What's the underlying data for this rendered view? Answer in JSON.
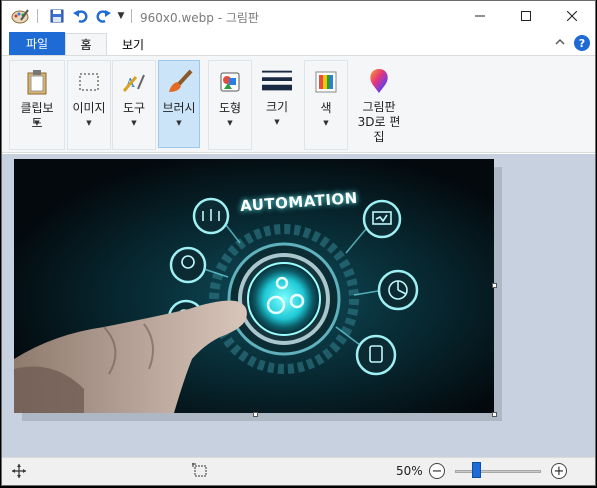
{
  "window": {
    "title": "960x0.webp - 그림판"
  },
  "tabs": {
    "file": "파일",
    "home": "홈",
    "view": "보기"
  },
  "help_label": "?",
  "ribbon": {
    "clipboard": "클립보드",
    "image": "이미지",
    "tools": "도구",
    "brushes": "브러시",
    "shapes": "도형",
    "size": "크기",
    "colors": "색",
    "edit_paint3d": "그림판 3D로 편집"
  },
  "image_text": "AUTOMATION",
  "status": {
    "zoom": "50%",
    "zoom_out": "−",
    "zoom_in": "+",
    "zoom_level": 0.5
  },
  "colors": {
    "accent": "#1e6bd6",
    "canvas_bg": "#c8d1e0"
  }
}
